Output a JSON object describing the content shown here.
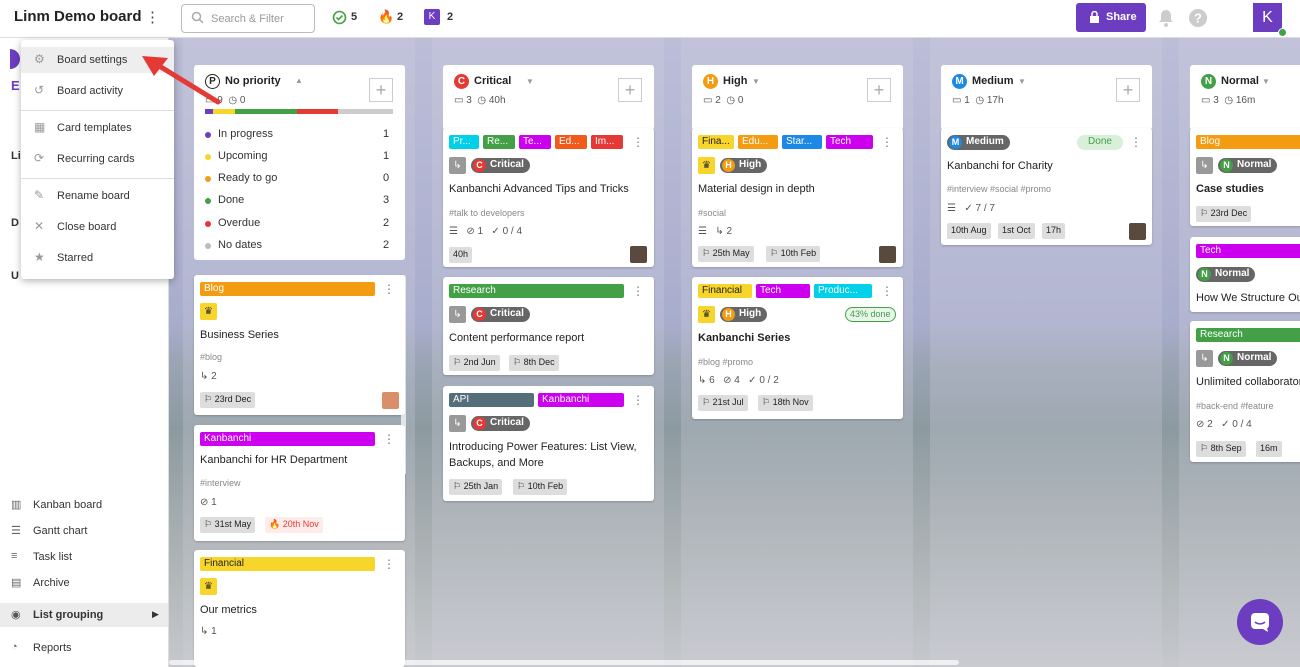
{
  "header": {
    "board_title": "Linm Demo board",
    "search_placeholder": "Search & Filter",
    "done_count": "5",
    "hot_count": "2",
    "user_count": "2",
    "user_initial": "K",
    "share_label": "Share",
    "profile_initial": "K"
  },
  "menu": {
    "items": [
      "Board settings",
      "Board activity",
      "Card templates",
      "Recurring cards",
      "Rename board",
      "Close board",
      "Starred"
    ]
  },
  "nav": {
    "kanban": "Kanban board",
    "gantt": "Gantt chart",
    "task_list": "Task list",
    "archive": "Archive",
    "list_grouping": "List grouping",
    "reports": "Reports"
  },
  "columns": [
    {
      "name": "No priority",
      "letter": "P",
      "cards": "9",
      "time": "0",
      "legend": [
        {
          "label": "In progress",
          "n": "1",
          "color": "#6c3cc1"
        },
        {
          "label": "Upcoming",
          "n": "1",
          "color": "#f8d52a"
        },
        {
          "label": "Ready to go",
          "n": "0",
          "color": "#f39c12"
        },
        {
          "label": "Done",
          "n": "3",
          "color": "#43a047"
        },
        {
          "label": "Overdue",
          "n": "2",
          "color": "#e53935"
        },
        {
          "label": "No dates",
          "n": "2",
          "color": "#bbb"
        }
      ]
    },
    {
      "name": "Critical",
      "letter": "C",
      "cards": "3",
      "time": "40h"
    },
    {
      "name": "High",
      "letter": "H",
      "cards": "2",
      "time": "0"
    },
    {
      "name": "Medium",
      "letter": "M",
      "cards": "1",
      "time": "17h"
    },
    {
      "name": "Normal",
      "letter": "N",
      "cards": "3",
      "time": "16m"
    }
  ],
  "cards": {
    "c1": {
      "tag": "Blog",
      "title": "Business Series",
      "hash": "#blog",
      "sub": "2",
      "date": "23rd Dec"
    },
    "c2": {
      "tag": "Kanbanchi",
      "title": "Kanbanchi for HR Department",
      "hash": "#interview",
      "att": "1",
      "start": "31st May",
      "due": "20th Nov"
    },
    "c3": {
      "tag": "Financial",
      "title": "Our metrics",
      "sub": "1"
    },
    "c4": {
      "tags": [
        "Pr...",
        "Re...",
        "Te...",
        "Ed...",
        "Im..."
      ],
      "prio": "Critical",
      "title": "Kanbanchi Advanced Tips and Tricks",
      "hash": "#talk to developers",
      "att": "1",
      "check": "0 / 4",
      "est": "40h"
    },
    "c5": {
      "tag": "Research",
      "prio": "Critical",
      "title": "Content performance report",
      "start": "2nd Jun",
      "due": "8th Dec"
    },
    "c6": {
      "tags": [
        "API",
        "Kanbanchi"
      ],
      "prio": "Critical",
      "title": "Introducing Power Features: List View, Backups, and More",
      "start": "25th Jan",
      "due": "10th Feb"
    },
    "c7": {
      "tags": [
        "Fina...",
        "Edu...",
        "Star...",
        "Tech"
      ],
      "prio": "High",
      "title": "Material design in depth",
      "hash": "#social",
      "sub": "2",
      "start": "25th May",
      "due": "10th Feb"
    },
    "c8": {
      "tags": [
        "Financial",
        "Tech",
        "Produc..."
      ],
      "prio": "High",
      "done": "43% done",
      "title": "Kanbanchi Series",
      "hash": "#blog #promo",
      "sub": "6",
      "att": "4",
      "check": "0 / 2",
      "start": "21st Jul",
      "due": "18th Nov"
    },
    "c9": {
      "prio": "Medium",
      "status": "Done",
      "title": "Kanbanchi for Charity",
      "hash": "#interview #social #promo",
      "check": "7 / 7",
      "d1": "10th Aug",
      "d2": "1st Oct",
      "est": "17h"
    },
    "c10": {
      "tag": "Blog",
      "prio": "Normal",
      "title": "Case studies",
      "date": "23rd Dec"
    },
    "c11": {
      "tag": "Tech",
      "prio": "Normal",
      "title": "How We Structure Ou"
    },
    "c12": {
      "tag": "Research",
      "prio": "Normal",
      "title": "Unlimited collaborator",
      "hash": "#back-end #feature",
      "att": "2",
      "check": "0 / 4",
      "date": "8th Sep",
      "est": "16m"
    }
  },
  "colors": {
    "accent": "#6c3cc1",
    "critical": "#e53935",
    "high": "#f39c12",
    "medium": "#1e88e5",
    "normal": "#43a047"
  }
}
